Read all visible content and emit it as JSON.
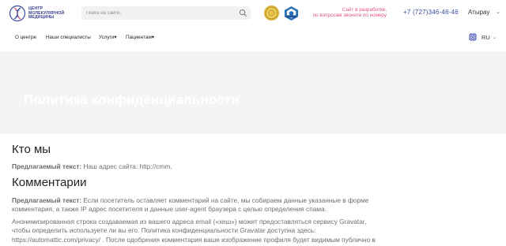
{
  "header": {
    "logo_alt": "ЦЕНТР МОЛЕКУЛЯРНОЙ МЕДИЦИНЫ",
    "logo_lines": [
      "ЦЕНТР",
      "МОЛЕКУЛЯРНОЙ",
      "МЕДИЦИНЫ"
    ],
    "search_placeholder": "Поиск на сайте..",
    "dev_note_lines": [
      "Сайт в разработке,",
      "по вопросам звоните по номеру"
    ],
    "phone": "+7 (727)346-46-46",
    "city": "Атырау",
    "colors": {
      "brand": "#3a4ba0",
      "accent_pink": "#e2567a"
    }
  },
  "nav": {
    "items": [
      "О центре",
      "Наши специалисты",
      "Услуги",
      "Пациентам"
    ],
    "language": "RU"
  },
  "hero": {
    "title": "Политика конфиденциальности"
  },
  "content": {
    "sections": [
      {
        "heading": "Кто мы",
        "paragraphs": [
          {
            "label": "Предлагаемый текст:",
            "text": " Наш адрес сайта: http://cmm."
          }
        ]
      },
      {
        "heading": "Комментарии",
        "paragraphs": [
          {
            "label": "Предлагаемый текст:",
            "text": " Если посетитель оставляет комментарий на сайте, мы собираем данные указанные в форме комментария, а также IP адрес посетителя и данные user-agent браузера с целью определения спама."
          },
          {
            "label": "",
            "text": "Анонимизированная строка создаваемая из вашего адреса email («хеш») может предоставляться сервису Gravatar, чтобы определить используете ли вы его. Политика конфиденциальности Gravatar доступна здесь: https://automattic.com/privacy/ . После одобрения комментария ваше изображение профиля будет видимым публично в"
          }
        ]
      }
    ]
  }
}
